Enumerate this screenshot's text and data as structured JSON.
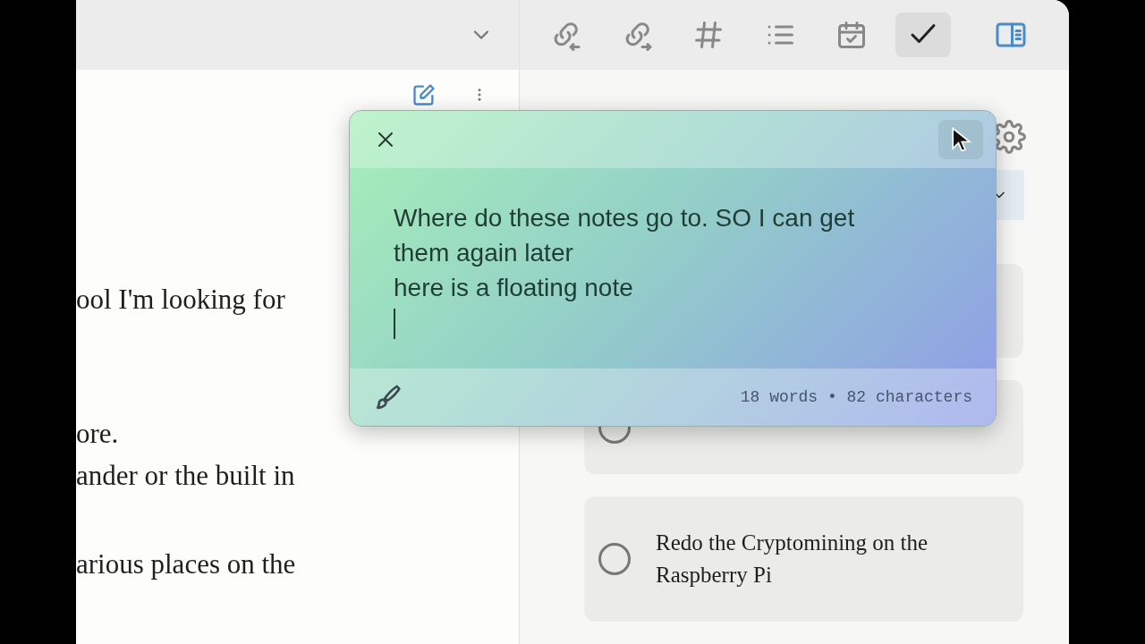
{
  "editor": {
    "lines": [
      "ool I'm looking for",
      "ore.",
      "ander or the built in",
      "arious places on the"
    ]
  },
  "toolbar": [
    {
      "kind": "backlinks",
      "selected": false
    },
    {
      "kind": "outlinks",
      "selected": false
    },
    {
      "kind": "tags",
      "selected": false
    },
    {
      "kind": "outline",
      "selected": false
    },
    {
      "kind": "calendar",
      "selected": false
    },
    {
      "kind": "tasks",
      "selected": true
    },
    {
      "kind": "sidebar",
      "selected": true
    }
  ],
  "tasks": [
    {
      "checked": false
    },
    {
      "text": "Redo the Cryptomining on the Raspberry Pi",
      "checked": false
    }
  ],
  "floating_note": {
    "text": "Where do these notes go to. SO I can get\nthem again later\nhere is a floating note",
    "stats": "18 words • 82 characters"
  }
}
